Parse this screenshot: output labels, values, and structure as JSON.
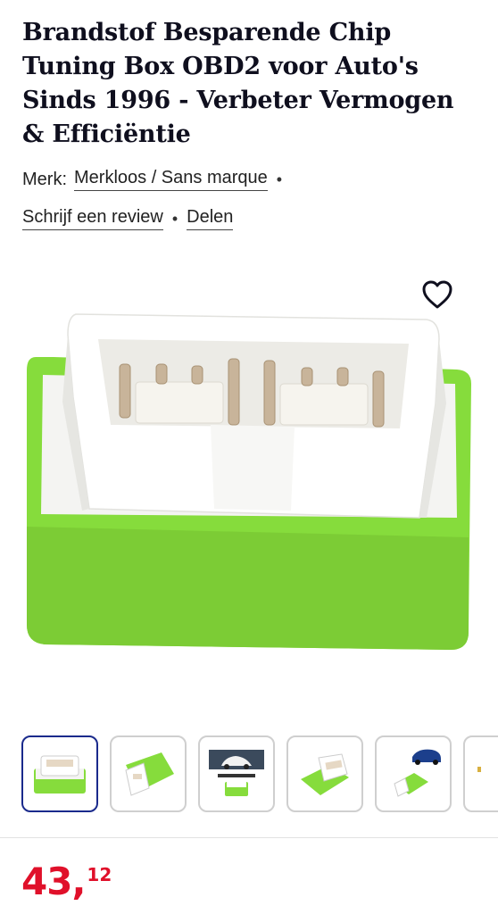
{
  "product": {
    "title": "Brandstof Besparende Chip Tuning Box OBD2 voor Auto's Sinds 1996 - Verbeter Vermogen & Efficiëntie",
    "brand_label": "Merk:",
    "brand_value": "Merkloos / Sans marque",
    "write_review": "Schrijf een review",
    "share": "Delen",
    "separator": "•"
  },
  "gallery": {
    "wishlist_icon": "heart-outline-icon",
    "thumbnails": [
      {
        "icon": "obd-device-front"
      },
      {
        "icon": "obd-device-side"
      },
      {
        "icon": "car-with-label"
      },
      {
        "icon": "obd-device-angle"
      },
      {
        "icon": "car-blue-with-device"
      },
      {
        "icon": "partial-thumbnail"
      }
    ]
  },
  "price": {
    "integer": "43",
    "comma": ",",
    "decimals": "12",
    "color": "#e0102a"
  },
  "colors": {
    "device_green": "#86dc3c",
    "device_white": "#f4f4f2",
    "active_thumb_border": "#1a2a8c"
  }
}
